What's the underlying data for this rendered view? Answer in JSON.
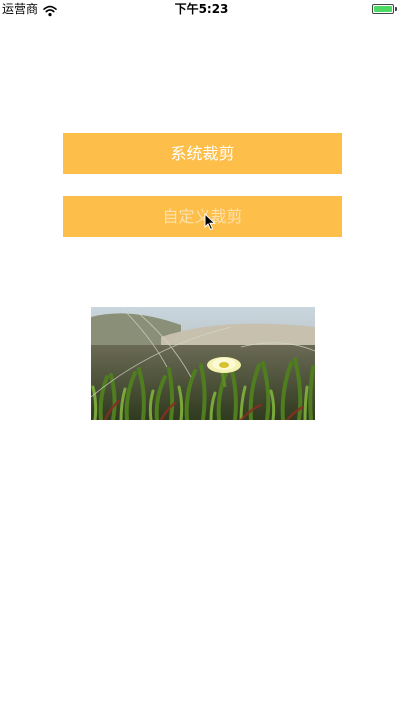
{
  "status_bar": {
    "carrier": "运营商",
    "wifi_icon": "wifi-icon",
    "time": "下午5:23",
    "battery_icon": "battery-icon",
    "battery_color": "#4cd964"
  },
  "buttons": {
    "system_crop_label": "系统裁剪",
    "custom_crop_label": "自定义裁剪",
    "accent_color": "#fdbe4a"
  },
  "image": {
    "subject": "flower-in-succulent-plants",
    "alt": ""
  }
}
